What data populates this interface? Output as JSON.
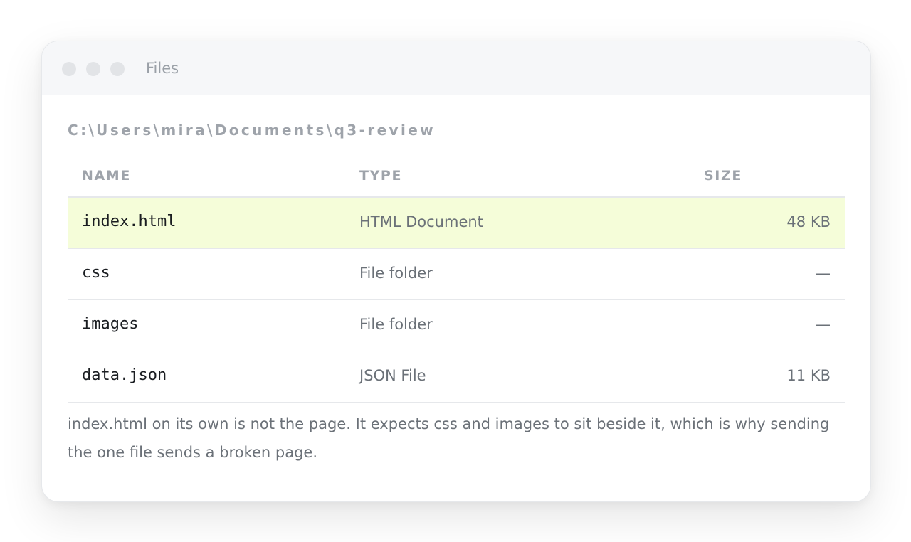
{
  "window": {
    "title": "Files"
  },
  "path": "C:\\Users\\mira\\Documents\\q3-review",
  "table": {
    "headers": {
      "name": "NAME",
      "type": "TYPE",
      "size": "SIZE"
    },
    "rows": [
      {
        "name": "index.html",
        "type": "HTML Document",
        "size": "48 KB",
        "selected": true
      },
      {
        "name": "css",
        "type": "File folder",
        "size": "—",
        "selected": false
      },
      {
        "name": "images",
        "type": "File folder",
        "size": "—",
        "selected": false
      },
      {
        "name": "data.json",
        "type": "JSON File",
        "size": "11 KB",
        "selected": false
      }
    ]
  },
  "note": "index.html on its own is not the page. It expects css and images to sit beside it, which is why sending the one file sends a broken page.",
  "colors": {
    "selected_row": "#f5fdd9",
    "muted_text": "#9ea3aa",
    "body_text": "#6b7178"
  }
}
